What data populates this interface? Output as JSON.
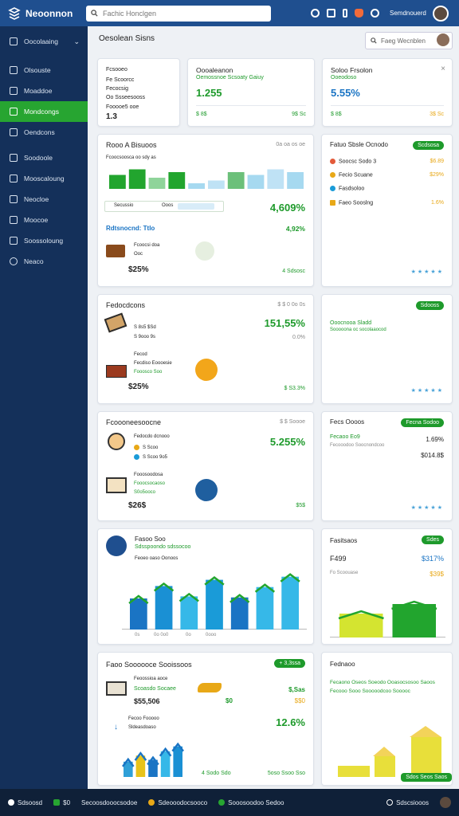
{
  "app": {
    "name": "Neoonnon"
  },
  "search": {
    "placeholder": "Fachic Honclgen"
  },
  "header": {
    "username": "Semdnouerd"
  },
  "sidebar": {
    "items": [
      {
        "label": "Oocolaaing",
        "active": false,
        "chevron": "⌄"
      },
      {
        "label": "Olsouste",
        "active": false
      },
      {
        "label": "Moaddoe",
        "active": false
      },
      {
        "label": "Mondcongs",
        "active": true
      },
      {
        "label": "Oendcons",
        "active": false
      },
      {
        "label": "Soodoole",
        "active": false
      },
      {
        "label": "Mooscaloung",
        "active": false
      },
      {
        "label": "Neocloe",
        "active": false
      },
      {
        "label": "Moocoe",
        "active": false
      },
      {
        "label": "Soossoloung",
        "active": false
      },
      {
        "label": "Neaco",
        "active": false
      }
    ]
  },
  "page": {
    "title": "Oesolean Sisns",
    "search_placeholder": "Faeg Wecnblen"
  },
  "kpi": [
    {
      "lines": [
        "Fcsooeo",
        "Fe Scoorcc",
        "Fecocsig",
        "Oo Ssseesooss",
        "Fooooe5 ooe",
        "1.3"
      ]
    },
    {
      "title": "Oooaleanon",
      "subtitle": "Oemossnoe Scsoaty Gaiuy",
      "value": "1.255",
      "foot_left": "$ 8$",
      "foot_right": "9$ Sc"
    },
    {
      "title": "Soloo Frsolon",
      "subtitle": "Ooeodoso",
      "value": "5.55%",
      "foot_left": "$ 8$",
      "foot_right": "3$ Sc",
      "close": "×"
    }
  ],
  "cards": {
    "c1": {
      "title": "Rooo A Bisuoos",
      "meta": "0a oa os oe",
      "sub": "Fcoocsoosca oo sdy as",
      "pct1": "4,609%",
      "tag1": "Secussio",
      "tag2": "Ooos",
      "label": "Rdtsnocnd: Ttlo",
      "pct2": "4,92%",
      "desc1": "Fcoocsi doa",
      "desc2": "Ooc",
      "price": "$25%",
      "foot": "4 Sdsosc"
    },
    "r1": {
      "title": "Fatuo Sbsle Ocnodo",
      "badge": "Scdsosa",
      "items": [
        "Soocsc Sodo 3",
        "Fecio Scuane",
        "Fasdsoloo",
        "Faeo Sooslng"
      ],
      "vals": [
        "$6.89",
        "$29%",
        "",
        "1.6%"
      ]
    },
    "c2": {
      "title": "Fedocdcons",
      "meta": "$ $ 0 0o 0s",
      "pct": "151,55%",
      "pct2": "0.0%",
      "line1": "S 8s5 $Sd",
      "line2": "S 9ooo 9s",
      "sub1": "Fecod",
      "sub2": "Fecdiso Eoooesie",
      "sub3": "Fooosco Soo",
      "price": "$25%",
      "foot": "$ S3.3%"
    },
    "r2": {
      "title": "",
      "badge": "Sdooss",
      "line1": "Ooocnooa Sladd",
      "line2": "Sooooona oc socolaaocod"
    },
    "c3": {
      "title": "Fcoooneesoocne",
      "meta": "$ $ Soooe",
      "pct": "5.255%",
      "line1": "Fedocdo dcnooo",
      "line2": "S Scoo",
      "line3": "S Scoo 9o5",
      "sub1": "Fooosoodosa",
      "sub2": "Fooocsocaoso",
      "sub3": "S0o5ooco",
      "price": "$26$",
      "foot": "$5$"
    },
    "r3": {
      "title": "Fecs Oooos",
      "badge": "Fecna Sodoo",
      "val1": "1.69%",
      "val2": "$014.8$",
      "line1": "Fecaoo Eo9",
      "line2": "Fecooodoo Soocnondcoo"
    },
    "c4": {
      "title": "Fasoo Soo",
      "sub": "Sdsspoondo sdssocoo",
      "meta": "Feoeo oaso Oonoos",
      "axis": [
        "5",
        "4",
        "3",
        "2",
        "1"
      ],
      "xlabels": [
        "0s",
        "0o 0o0",
        "0o",
        "0ooo"
      ]
    },
    "r4": {
      "title": "Fasitsaos",
      "badge": "Sdes",
      "val1": "F499",
      "val2": "$317%",
      "sub": "Fo Scoouase",
      "val3": "$39$",
      "axis": [
        "3",
        "2",
        "1"
      ]
    },
    "c5": {
      "title": "Faoo Soooooce Sooissoos",
      "badge": "+ 3,3ssa",
      "sub1": "Feoossioa aoce",
      "sub2": "Scoasdo Socaee",
      "price": "$55,506",
      "pct": "$,Sas",
      "tag": "$0",
      "tag2": "$$0",
      "line1": "Fecoo Fooooo",
      "line2": "Sldeasdoaso",
      "pct2": "12.6%",
      "foot1": "4 Sodo Sdo",
      "foot2": "5oso Ssoo Sso"
    },
    "r5": {
      "title": "Fednaoo",
      "sub": "Fecaono Oseos Soeodo Ooasocsosoo Saoos Fecooo Sooo Sooooodcoo Sooooc",
      "badge": "Sdos Seos Saos"
    }
  },
  "bottom": {
    "items": [
      "Sdsoosd",
      "$0",
      "Secoosdooocsodoe",
      "Sdeooodocsooco",
      "Sooosoodoo Sedoo"
    ],
    "right": "Sdscsiooos"
  },
  "chart_data": [
    {
      "type": "bar",
      "series": [
        {
          "name": "",
          "values": [
            5,
            7,
            4,
            6,
            2,
            3,
            6,
            5,
            7,
            6
          ]
        }
      ]
    },
    {
      "type": "bar",
      "categories": [
        "0s",
        "0o",
        "0o0",
        "0ooo",
        "0o",
        "0o",
        "0s"
      ],
      "series": [
        {
          "name": "",
          "values": [
            3,
            4.2,
            3.2,
            4.8,
            3.1,
            4.1,
            5.1
          ]
        }
      ]
    },
    {
      "type": "bar",
      "series": [
        {
          "name": "",
          "values": [
            3,
            4.2
          ]
        }
      ]
    },
    {
      "type": "bar",
      "series": [
        {
          "name": "",
          "values": [
            2.5,
            3.5,
            2.8,
            4.2,
            5
          ]
        }
      ]
    }
  ]
}
